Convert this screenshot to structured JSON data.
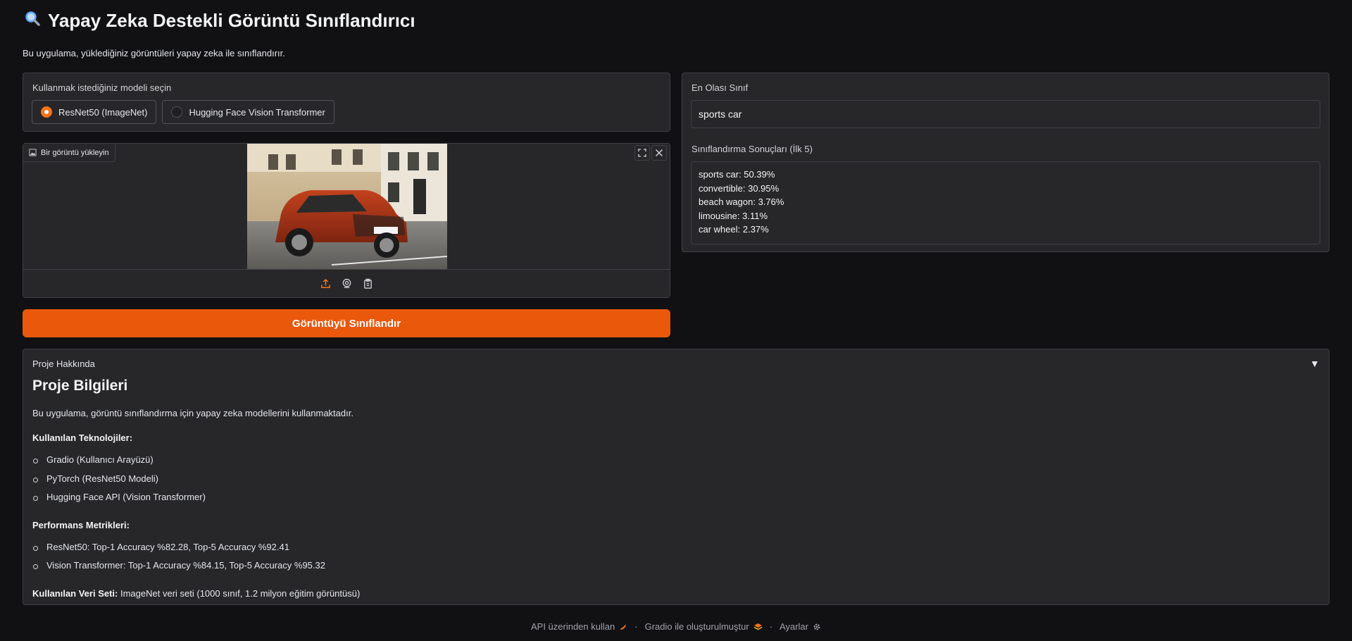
{
  "header": {
    "title": "Yapay Zeka Destekli Görüntü Sınıflandırıcı",
    "subtitle": "Bu uygulama, yüklediğiniz görüntüleri yapay zeka ile sınıflandırır."
  },
  "model_select": {
    "label": "Kullanmak istediğiniz modeli seçin",
    "options": [
      "ResNet50 (ImageNet)",
      "Hugging Face Vision Transformer"
    ],
    "selected": "ResNet50 (ImageNet)"
  },
  "image_input": {
    "label": "Bir görüntü yükleyin"
  },
  "classify_button": "Görüntüyü Sınıflandır",
  "results": {
    "top_label": "En Olası Sınıf",
    "top_value": "sports car",
    "list_label": "Sınıflandırma Sonuçları (İlk 5)",
    "items": [
      "sports car: 50.39%",
      "convertible: 30.95%",
      "beach wagon: 3.76%",
      "limousine: 3.11%",
      "car wheel: 2.37%"
    ]
  },
  "about": {
    "accordion_label": "Proje Hakkında",
    "heading": "Proje Bilgileri",
    "intro": "Bu uygulama, görüntü sınıflandırma için yapay zeka modellerini kullanmaktadır.",
    "tech_title": "Kullanılan Teknolojiler:",
    "tech_items": [
      "Gradio (Kullanıcı Arayüzü)",
      "PyTorch (ResNet50 Modeli)",
      "Hugging Face API (Vision Transformer)"
    ],
    "metrics_title": "Performans Metrikleri:",
    "metrics_items": [
      "ResNet50: Top-1 Accuracy %82.28, Top-5 Accuracy %92.41",
      "Vision Transformer: Top-1 Accuracy %84.15, Top-5 Accuracy %95.32"
    ],
    "dataset_title": "Kullanılan Veri Seti:",
    "dataset_text": " ImageNet veri seti (1000 sınıf, 1.2 milyon eğitim görüntüsü)"
  },
  "footer": {
    "api": "API üzerinden kullan",
    "built": "Gradio ile oluşturulmuştur",
    "settings": "Ayarlar",
    "separator": "·"
  },
  "colors": {
    "accent": "#ea580c",
    "panel": "#27272a",
    "background": "#111113"
  }
}
